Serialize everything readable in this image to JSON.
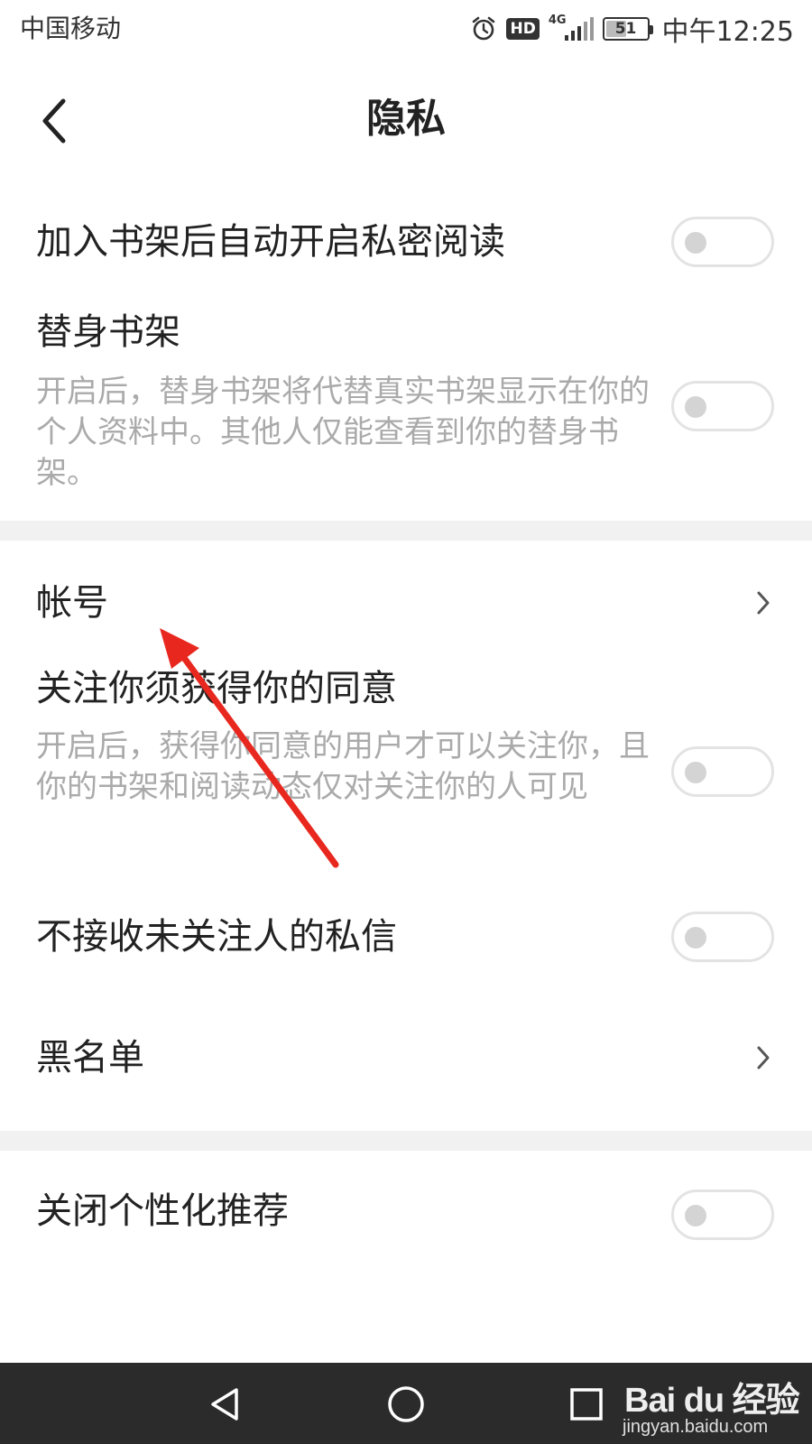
{
  "status_bar": {
    "carrier": "中国移动",
    "hd": "HD",
    "network": "4G",
    "battery": "51",
    "battery_percent": 51,
    "time": "中午12:25",
    "icons": [
      "alarm-icon",
      "hd-icon",
      "signal-icon",
      "battery-icon"
    ]
  },
  "header": {
    "title": "隐私",
    "back_icon": "back-chevron-icon"
  },
  "settings": [
    {
      "title": "加入书架后自动开启私密阅读",
      "type": "toggle",
      "on": false
    },
    {
      "title": "替身书架",
      "desc": "开启后，替身书架将代替真实书架显示在你的个人资料中。其他人仅能查看到你的替身书架。",
      "type": "toggle",
      "on": false
    },
    {
      "title": "帐号",
      "type": "link"
    },
    {
      "title": "关注你须获得你的同意",
      "desc": "开启后，获得你同意的用户才可以关注你，且你的书架和阅读动态仅对关注你的人可见",
      "type": "toggle",
      "on": false
    },
    {
      "title": "不接收未关注人的私信",
      "type": "toggle",
      "on": false
    },
    {
      "title": "黑名单",
      "type": "link"
    },
    {
      "title": "关闭个性化推荐",
      "type": "toggle",
      "on": false
    }
  ],
  "colors": {
    "toggle_border": "#e3e3e3",
    "toggle_knob": "#d4d4d4",
    "desc_text": "#aaaaaa",
    "divider": "#f1f1f1",
    "nav_bar": "#2b2b2b",
    "annotation_arrow": "#e8281f"
  },
  "nav_bar": {
    "icons": [
      "nav-back-triangle-icon",
      "nav-home-circle-icon",
      "nav-recent-square-icon"
    ]
  },
  "watermark": {
    "logo": "Bai du 经验",
    "url": "jingyan.baidu.com"
  }
}
